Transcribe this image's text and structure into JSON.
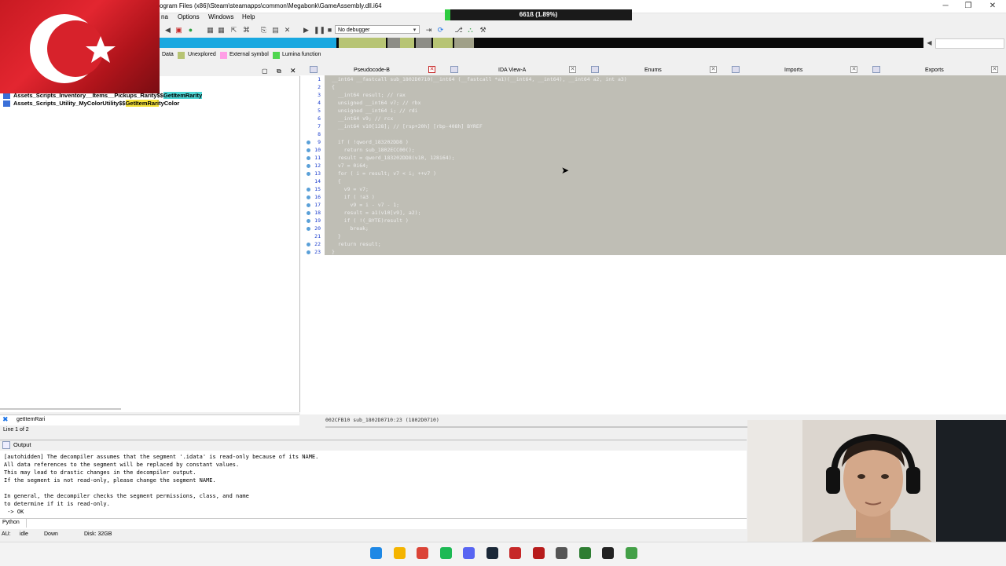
{
  "window": {
    "title": "ogram Files (x86)\\Steam\\steamapps\\common\\Megabonk\\GameAssembly.dll.i64",
    "progress_text": "661ß (1.89%)",
    "progress_fraction": 0.0189,
    "minimize": "─",
    "maximize": "❐",
    "close": "✕"
  },
  "menubar": {
    "items": [
      "na",
      "Options",
      "Windows",
      "Help"
    ]
  },
  "toolbar": {
    "debugger": "No debugger"
  },
  "legend": [
    {
      "label": "Data",
      "color": "#b0b0b0"
    },
    {
      "label": "Unexplored",
      "color": "#b7c474"
    },
    {
      "label": "External symbol",
      "color": "#ff9de6"
    },
    {
      "label": "Lumina function",
      "color": "#4fd64f"
    }
  ],
  "functions": {
    "items": [
      {
        "prefix": "Assets_Scripts_Inventory__Items__Pickups_Rarity$$",
        "match": "GetItemRari",
        "suffix": "ty"
      },
      {
        "prefix": "Assets_Scripts_Utility_MyColorUtility$$",
        "match": "GetItemRari",
        "suffix": "tyColor"
      }
    ],
    "search_value": "getItemRari",
    "line_info": "Line 1 of 2"
  },
  "tabs": [
    "Pseudocode-B",
    "IDA View-A",
    "Enums",
    "Imports",
    "Exports"
  ],
  "code": {
    "lines": [
      "__int64 __fastcall sub_1802D0710(__int64 (__fastcall *a1)(__int64, __int64), __int64 a2, int a3)",
      "{",
      "  __int64 result; // rax",
      "  unsigned __int64 v7; // rbx",
      "  unsigned __int64 i; // rdi",
      "  __int64 v9; // rcx",
      "  __int64 v10[128]; // [rsp+20h] [rbp-408h] BYREF",
      "",
      "  if ( !qword_183202DD8 )",
      "    return sub_1802ECC00();",
      "  result = qword_183202DD8(v10, 128i64);",
      "  v7 = 0i64;",
      "  for ( i = result; v7 < i; ++v7 )",
      "  {",
      "    v9 = v7;",
      "    if ( !a3 )",
      "      v9 = i - v7 - 1;",
      "    result = a1(v10[v9], a2);",
      "    if ( !(_BYTE)result )",
      "      break;",
      "  }",
      "  return result;",
      "}"
    ],
    "status": "002CFB10 sub_1802D0710:23 (1802D0710)"
  },
  "output": {
    "title": "Output",
    "lines": [
      "[autohidden] The decompiler assumes that the segment '.idata' is read-only because of its NAME.",
      "All data references to the segment will be replaced by constant values.",
      "This may lead to drastic changes in the decompiler output.",
      "If the segment is not read-only, please change the segment NAME.",
      "",
      "In general, the decompiler checks the segment permissions, class, and name",
      "to determine if it is read-only.",
      " -> OK"
    ],
    "python_label": "Python"
  },
  "statusbar": {
    "au": "AU:",
    "state": "idle",
    "direction": "Down",
    "disk": "Disk: 32GB"
  },
  "taskbar": {
    "apps": [
      {
        "name": "windows-start-icon",
        "color": "#1e88e5"
      },
      {
        "name": "file-explorer-icon",
        "color": "#f4b400"
      },
      {
        "name": "chrome-icon",
        "color": "#db4437"
      },
      {
        "name": "spotify-icon",
        "color": "#1db954"
      },
      {
        "name": "discord-icon",
        "color": "#5865f2"
      },
      {
        "name": "steam-icon",
        "color": "#1b2838"
      },
      {
        "name": "recorder-icon",
        "color": "#c62828"
      },
      {
        "name": "ida-icon",
        "color": "#b71c1c"
      },
      {
        "name": "settings-icon",
        "color": "#555555"
      },
      {
        "name": "app-icon",
        "color": "#2e7d32"
      },
      {
        "name": "terminal-icon",
        "color": "#222222"
      },
      {
        "name": "notepad-icon",
        "color": "#43a047"
      }
    ]
  }
}
